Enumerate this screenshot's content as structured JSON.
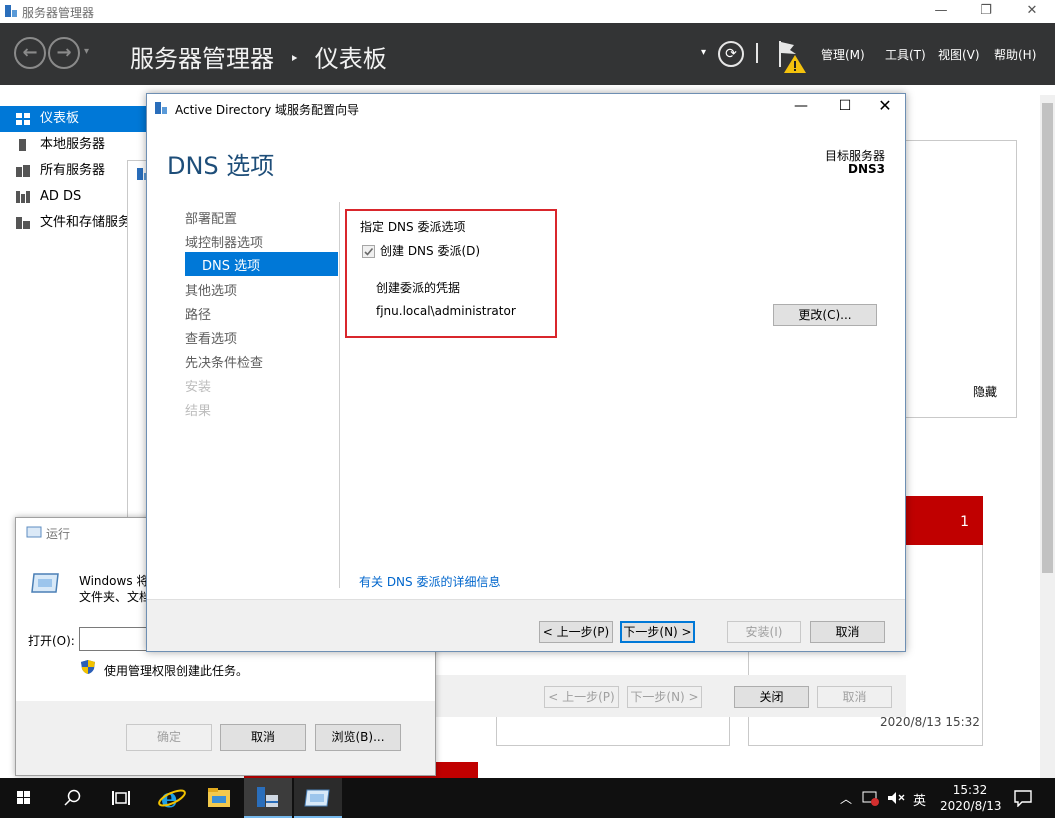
{
  "window": {
    "title": "服务器管理器",
    "controls": {
      "minimize": "—",
      "restore": "❐",
      "close": "✕"
    }
  },
  "header": {
    "breadcrumb_app": "服务器管理器",
    "breadcrumb_sep": "‣",
    "breadcrumb_page": "仪表板",
    "menus": [
      "管理(M)",
      "工具(T)",
      "视图(V)",
      "帮助(H)"
    ]
  },
  "sidebar": {
    "items": [
      {
        "label": "仪表板",
        "icon": "dashboard-icon",
        "selected": true
      },
      {
        "label": "本地服务器",
        "icon": "server-icon"
      },
      {
        "label": "所有服务器",
        "icon": "servers-icon"
      },
      {
        "label": "AD DS",
        "icon": "adds-icon"
      },
      {
        "label": "文件和存储服务",
        "icon": "file-storage-icon"
      }
    ]
  },
  "background": {
    "hide_label": "隐藏",
    "badge_count": "1",
    "timestamp": "2020/8/13 15:32",
    "buttons": {
      "prev": "< 上一步(P)",
      "next": "下一步(N) >",
      "close": "关闭",
      "cancel": "取消"
    }
  },
  "wizard": {
    "title": "Active Directory 域服务配置向导",
    "heading": "DNS 选项",
    "target_label": "目标服务器",
    "target_value": "DNS3",
    "steps": [
      {
        "label": "部署配置",
        "state": "done"
      },
      {
        "label": "域控制器选项",
        "state": "done"
      },
      {
        "label": "DNS 选项",
        "state": "active"
      },
      {
        "label": "其他选项",
        "state": "pending"
      },
      {
        "label": "路径",
        "state": "pending"
      },
      {
        "label": "查看选项",
        "state": "pending"
      },
      {
        "label": "先决条件检查",
        "state": "pending"
      },
      {
        "label": "安装",
        "state": "disabled"
      },
      {
        "label": "结果",
        "state": "disabled"
      }
    ],
    "section_title": "指定 DNS 委派选项",
    "checkbox_label": "创建 DNS 委派(D)",
    "checkbox_checked": true,
    "cred_label": "创建委派的凭据",
    "cred_value": "fjnu.local\\administrator",
    "change_button": "更改(C)...",
    "more_info_link": "有关 DNS 委派的详细信息",
    "buttons": {
      "prev": "< 上一步(P)",
      "next": "下一步(N) >",
      "install": "安装(I)",
      "cancel": "取消"
    },
    "highlight_color": "#d9262c"
  },
  "run_dialog": {
    "title": "运行",
    "desc_line1": "Windows 将",
    "desc_line2": "文件夹、文档",
    "open_label": "打开(O):",
    "open_value": "",
    "admin_note": "使用管理权限创建此任务。",
    "buttons": {
      "ok": "确定",
      "cancel": "取消",
      "browse": "浏览(B)..."
    }
  },
  "taskbar": {
    "ime": "英",
    "time": "15:32",
    "date": "2020/8/13",
    "icons": [
      "start-icon",
      "search-icon",
      "task-view-icon",
      "ie-icon",
      "explorer-icon",
      "server-manager-icon",
      "run-icon"
    ]
  },
  "colors": {
    "accent": "#0078d7",
    "header_bg": "#333435",
    "selected_sidebar": "#0078d7",
    "alert_red": "#c00000"
  }
}
